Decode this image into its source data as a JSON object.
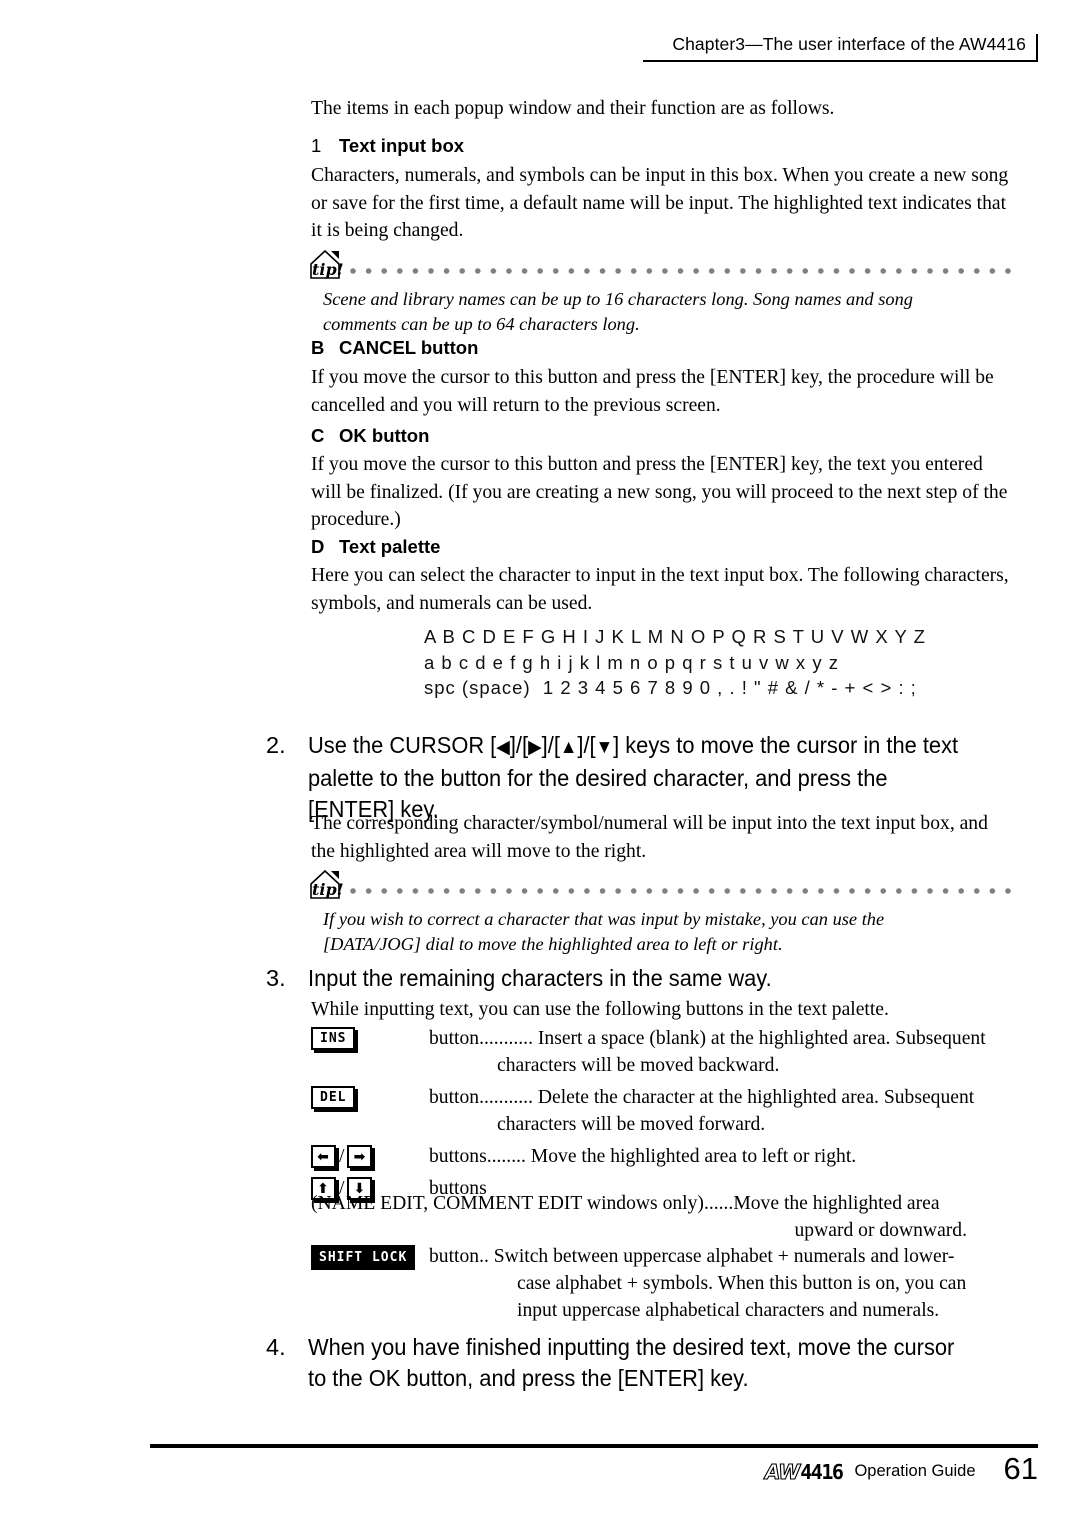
{
  "header": {
    "title": "Chapter3—The user interface of the AW4416"
  },
  "intro": {
    "text": "The items in each popup window and their function are as follows."
  },
  "sections": [
    {
      "marker": "1",
      "heading": "Text input box",
      "body": "Characters, numerals, and symbols can be input in this box. When you create a new song or save for the first time, a default name will be input. The highlighted text indicates that it is being changed."
    },
    {
      "marker": "B",
      "heading": "CANCEL button",
      "body": "If you move the cursor to this button and press the [ENTER] key, the procedure will be cancelled and you will return to the previous screen."
    },
    {
      "marker": "C",
      "heading": "OK button",
      "body": "If you move the cursor to this button and press the [ENTER] key, the text you entered will be finalized. (If you are creating a new song, you will proceed to the next step of the procedure.)"
    },
    {
      "marker": "D",
      "heading": "Text palette",
      "body": "Here you can select the character to input in the text input box. The following characters, symbols, and numerals can be used."
    }
  ],
  "tips": [
    {
      "icon": "tip-icon",
      "text": "Scene and library names can be up to 16 characters long. Song names and song comments can be up to 64 characters long."
    },
    {
      "icon": "tip-icon",
      "text": "If you wish to correct a character that was input by mistake, you can use the [DATA/JOG] dial to move the highlighted area to left or right."
    }
  ],
  "palette": {
    "uppercase": "A B C D E F G H I J K L M N O P Q R S T U V W X Y Z",
    "lowercase": "a b c d e f g h i j k l m n o p q r s t u v w x y z",
    "symbols": "spc (space)  1 2 3 4 5 6 7 8 9 0 , . ! \" # & / * - + < > : ;"
  },
  "steps": {
    "step2": {
      "num": "2.",
      "text_part1": "Use the CURSOR [",
      "arrow_left": "◀",
      "sep1": "]/[",
      "arrow_right": "▶",
      "sep2": "]/[",
      "arrow_up": "▲",
      "sep3": "]/[",
      "arrow_down": "▼",
      "text_part2": "] keys to move the cursor in the text palette to the button for the desired character, and press the [ENTER] key.",
      "body": "The corresponding character/symbol/numeral will be input into the text input box, and the highlighted area will move to the right."
    },
    "step3": {
      "num": "3.",
      "text": "Input the remaining characters in the same way.",
      "body": "While inputting text, you can use the following buttons in the text palette."
    },
    "step4": {
      "num": "4.",
      "text": "When you have finished inputting the desired text, move the cursor to the OK button, and press the [ENTER] key."
    }
  },
  "buttons": [
    {
      "key": "INS",
      "label": "button",
      "dots": "...........",
      "desc_line1": "Insert a space (blank) at the highlighted area. Subsequent",
      "desc_line2": "characters will be moved backward."
    },
    {
      "key": "DEL",
      "label": "button",
      "dots": "...........",
      "desc_line1": "Delete the character at the highlighted area. Subsequent",
      "desc_line2": "characters will be moved forward."
    },
    {
      "key_left": "⬅",
      "key_right": "➡",
      "label": "buttons",
      "dots": "........",
      "desc_line1": "Move the highlighted area to left or right.",
      "desc_line2": ""
    },
    {
      "key_left": "⬆",
      "key_right": "⬇",
      "label": "buttons",
      "dots": "",
      "desc_line1": "",
      "desc_line2": ""
    }
  ],
  "updown_note": {
    "condition": "(NAME EDIT, COMMENT EDIT windows only)",
    "dots": "......",
    "desc_line1": "Move the highlighted area",
    "desc_line2": "upward or downward."
  },
  "shift_lock": {
    "key": "SHIFT LOCK",
    "label": "button",
    "dots": "..",
    "desc_line1": "Switch between uppercase alphabet + numerals and lower-",
    "desc_line2": "case alphabet + symbols. When this button is on, you can",
    "desc_line3": "input uppercase alphabetical characters and numerals."
  },
  "footer": {
    "logo_aw": "AW",
    "logo_num": "4416",
    "label": "Operation Guide",
    "page": "61"
  }
}
